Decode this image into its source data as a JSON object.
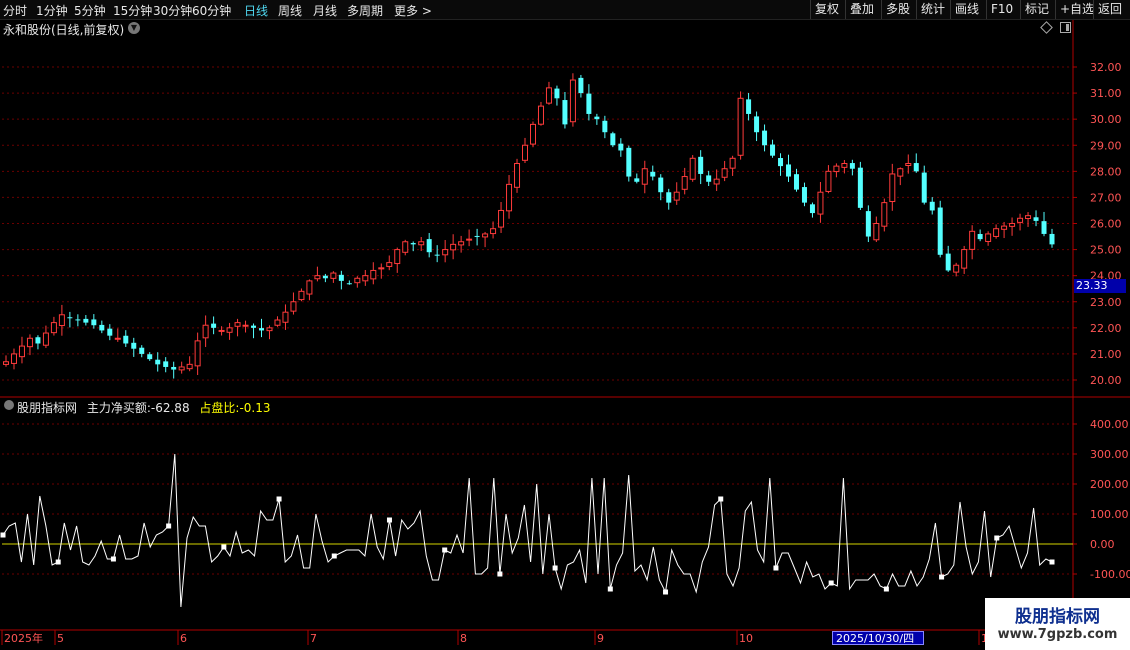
{
  "toolbar": {
    "left_items": [
      {
        "label": "分时",
        "active": false
      },
      {
        "label": "1分钟",
        "active": false
      },
      {
        "label": "5分钟",
        "active": false
      },
      {
        "label": "15分钟",
        "active": false
      },
      {
        "label": "30分钟",
        "active": false
      },
      {
        "label": "60分钟",
        "active": false
      },
      {
        "label": "日线",
        "active": true
      },
      {
        "label": "周线",
        "active": false
      },
      {
        "label": "月线",
        "active": false
      },
      {
        "label": "多周期",
        "active": false
      },
      {
        "label": "更多 >",
        "active": false
      }
    ],
    "right_items": [
      "复权",
      "叠加",
      "多股",
      "统计",
      "画线",
      "F10",
      "标记",
      "+自选",
      "返回"
    ]
  },
  "stock_title": "永和股份(日线,前复权)",
  "price_panel": {
    "y_ticks": [
      "32.00",
      "31.00",
      "30.00",
      "29.00",
      "28.00",
      "27.00",
      "26.00",
      "25.00",
      "24.00",
      "23.00",
      "22.00",
      "21.00",
      "20.00"
    ],
    "current_price_tag": "23.33"
  },
  "indicator": {
    "name": "股朋指标网",
    "label1": "主力净买额:",
    "value1": "-62.88",
    "label2": "占盘比:",
    "value2": "-0.13",
    "y_ticks": [
      "400.00",
      "300.00",
      "200.00",
      "100.00",
      "0.00",
      "-100.00"
    ]
  },
  "x_axis": {
    "labels": [
      "2025年",
      "5",
      "6",
      "7",
      "8",
      "9",
      "10",
      "1"
    ],
    "cursor_date": "2025/10/30/四"
  },
  "watermark": {
    "line1": "股朋指标网",
    "line2": "www.7gpzb.com"
  },
  "colors": {
    "up": "#ff3b3b",
    "down": "#54ffff",
    "grid": "#6b0000",
    "zero_line": "#d4d400",
    "line": "#ffffff",
    "axis_text": "#ff5555"
  },
  "chart_data": [
    {
      "type": "candlestick",
      "title": "永和股份(日线,前复权)",
      "ylim": [
        19.6,
        33.0
      ],
      "x_start": "2025-04",
      "x_months": [
        "5",
        "6",
        "7",
        "8",
        "9",
        "10",
        "11"
      ],
      "close": [
        20.7,
        21.0,
        21.3,
        21.6,
        21.4,
        21.8,
        22.2,
        22.5,
        22.4,
        22.3,
        22.2,
        22.1,
        21.9,
        21.7,
        21.6,
        21.4,
        21.2,
        21.0,
        20.8,
        20.6,
        20.5,
        20.4,
        20.5,
        20.6,
        21.5,
        22.1,
        22.0,
        21.9,
        22.0,
        22.2,
        22.1,
        22.0,
        21.9,
        22.0,
        22.3,
        22.6,
        23.0,
        23.4,
        23.8,
        24.0,
        23.9,
        24.1,
        23.8,
        23.7,
        23.9,
        24.0,
        24.2,
        24.3,
        24.5,
        25.0,
        25.3,
        25.2,
        25.3,
        24.9,
        24.8,
        25.0,
        25.2,
        25.3,
        25.4,
        25.5,
        25.6,
        25.8,
        26.5,
        27.5,
        28.3,
        29.0,
        29.8,
        30.5,
        31.2,
        30.8,
        29.8,
        31.5,
        31.0,
        30.2,
        30.0,
        29.5,
        29.0,
        28.8,
        27.8,
        27.6,
        28.1,
        27.8,
        27.2,
        26.8,
        27.2,
        27.8,
        28.5,
        27.9,
        27.6,
        27.7,
        28.1,
        28.5,
        30.8,
        30.2,
        29.5,
        29.0,
        28.6,
        28.2,
        27.8,
        27.3,
        26.8,
        26.4,
        27.2,
        28.0,
        28.2,
        28.3,
        28.1,
        26.6,
        25.5,
        26.0,
        26.8,
        27.9,
        28.1,
        28.3,
        28.0,
        26.8,
        26.5,
        24.8,
        24.2,
        24.4,
        25.0,
        25.7,
        25.4,
        25.6,
        25.8,
        25.9,
        26.0,
        26.2,
        26.3,
        26.1,
        25.6,
        25.2
      ]
    },
    {
      "type": "line",
      "series": [
        {
          "name": "主力净买额",
          "values": [
            30,
            60,
            70,
            -60,
            100,
            -70,
            160,
            60,
            -70,
            -60,
            70,
            -20,
            60,
            -60,
            -70,
            -40,
            10,
            -50,
            -50,
            30,
            -50,
            -50,
            -40,
            70,
            -10,
            30,
            40,
            60,
            300,
            -210,
            20,
            90,
            60,
            60,
            -60,
            -40,
            -10,
            -40,
            40,
            -30,
            -20,
            -40,
            110,
            80,
            80,
            150,
            -60,
            -40,
            30,
            -80,
            -80,
            100,
            10,
            -60,
            -40,
            -30,
            -20,
            -20,
            -20,
            -40,
            100,
            -10,
            -50,
            80,
            -40,
            80,
            50,
            70,
            110,
            -40,
            -120,
            -120,
            -20,
            -30,
            30,
            -30,
            220,
            -100,
            -100,
            -80,
            220,
            -100,
            100,
            -30,
            20,
            130,
            -60,
            200,
            -100,
            100,
            -80,
            -150,
            -70,
            -60,
            -20,
            -130,
            220,
            -100,
            220,
            -150,
            -70,
            -30,
            230,
            -90,
            -70,
            -120,
            -10,
            -120,
            -160,
            -20,
            -70,
            -100,
            -100,
            -160,
            -60,
            -10,
            130,
            150,
            -100,
            -140,
            -80,
            110,
            140,
            -20,
            -60,
            220,
            -80,
            -30,
            -30,
            -80,
            -130,
            -60,
            -110,
            -100,
            -150,
            -130,
            -140,
            220,
            -150,
            -120,
            -120,
            -120,
            -100,
            -140,
            -150,
            -100,
            -140,
            -140,
            -90,
            -140,
            -110,
            -50,
            70,
            -110,
            -100,
            -70,
            140,
            -10,
            -100,
            -60,
            110,
            -110,
            20,
            30,
            60,
            -10,
            -80,
            -30,
            120,
            -70,
            -50,
            -60
          ]
        }
      ],
      "ylim": [
        -280,
        430
      ],
      "zero_line": 0,
      "markers_note": "small white squares at selected points"
    }
  ]
}
